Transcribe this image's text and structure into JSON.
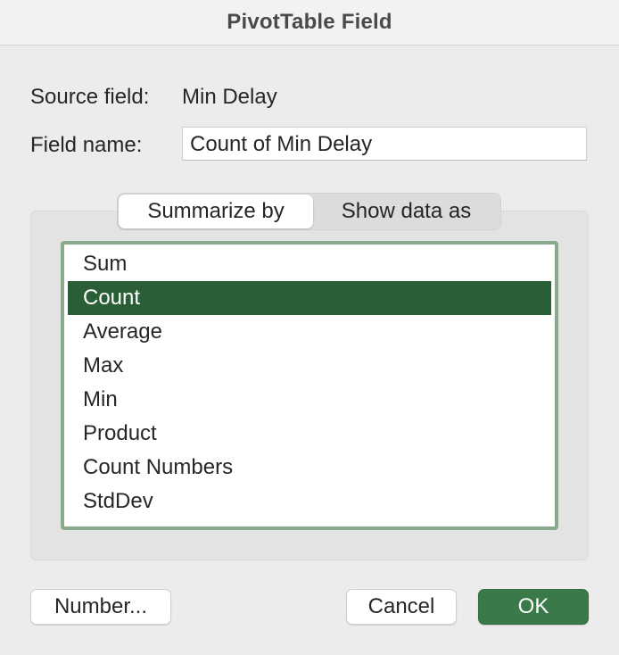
{
  "window": {
    "title": "PivotTable Field"
  },
  "source_field": {
    "label": "Source field:",
    "value": "Min Delay"
  },
  "field_name": {
    "label": "Field name:",
    "value": "Count of Min Delay"
  },
  "tabs": [
    {
      "label": "Summarize by",
      "active": true
    },
    {
      "label": "Show data as",
      "active": false
    }
  ],
  "summarize_list": {
    "items": [
      "Sum",
      "Count",
      "Average",
      "Max",
      "Min",
      "Product",
      "Count Numbers",
      "StdDev"
    ],
    "selected": "Count"
  },
  "buttons": {
    "number": "Number...",
    "cancel": "Cancel",
    "ok": "OK"
  },
  "colors": {
    "accent": "#3a7a4a",
    "selection": "#2a5e37",
    "focus_ring": "#8aa98c"
  }
}
